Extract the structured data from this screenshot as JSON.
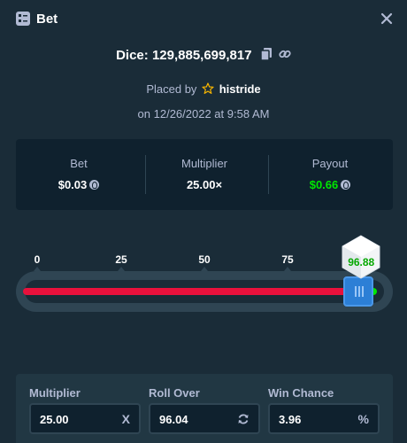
{
  "header": {
    "title": "Bet",
    "title_icon": "bet-list-icon",
    "close_icon": "close-icon"
  },
  "bet": {
    "dice_label": "Dice: 129,885,699,817",
    "placed_by_prefix": "Placed by",
    "username": "histride",
    "date_line": "on 12/26/2022 at 9:58 AM"
  },
  "stats": [
    {
      "label": "Bet",
      "value": "$0.03",
      "currency_icon": "coin-icon"
    },
    {
      "label": "Multiplier",
      "value": "25.00×"
    },
    {
      "label": "Payout",
      "value": "$0.66",
      "currency_icon": "coin-icon",
      "color": "#00e701"
    }
  ],
  "slider": {
    "ticks": [
      "0",
      "25",
      "50",
      "75"
    ],
    "roll_over": 96.04,
    "result": "96.88",
    "lose_color": "#e9113c",
    "win_color": "#00e701"
  },
  "fields": [
    {
      "label": "Multiplier",
      "value": "25.00",
      "suffix": "X"
    },
    {
      "label": "Roll Over",
      "value": "96.04",
      "suffix_icon": "refresh-icon"
    },
    {
      "label": "Win Chance",
      "value": "3.96",
      "suffix": "%"
    }
  ],
  "colors": {
    "background": "#1a2c38",
    "panel": "#0f212e",
    "accent_blue": "#2c7fd6",
    "muted_text": "#b1bad3"
  }
}
